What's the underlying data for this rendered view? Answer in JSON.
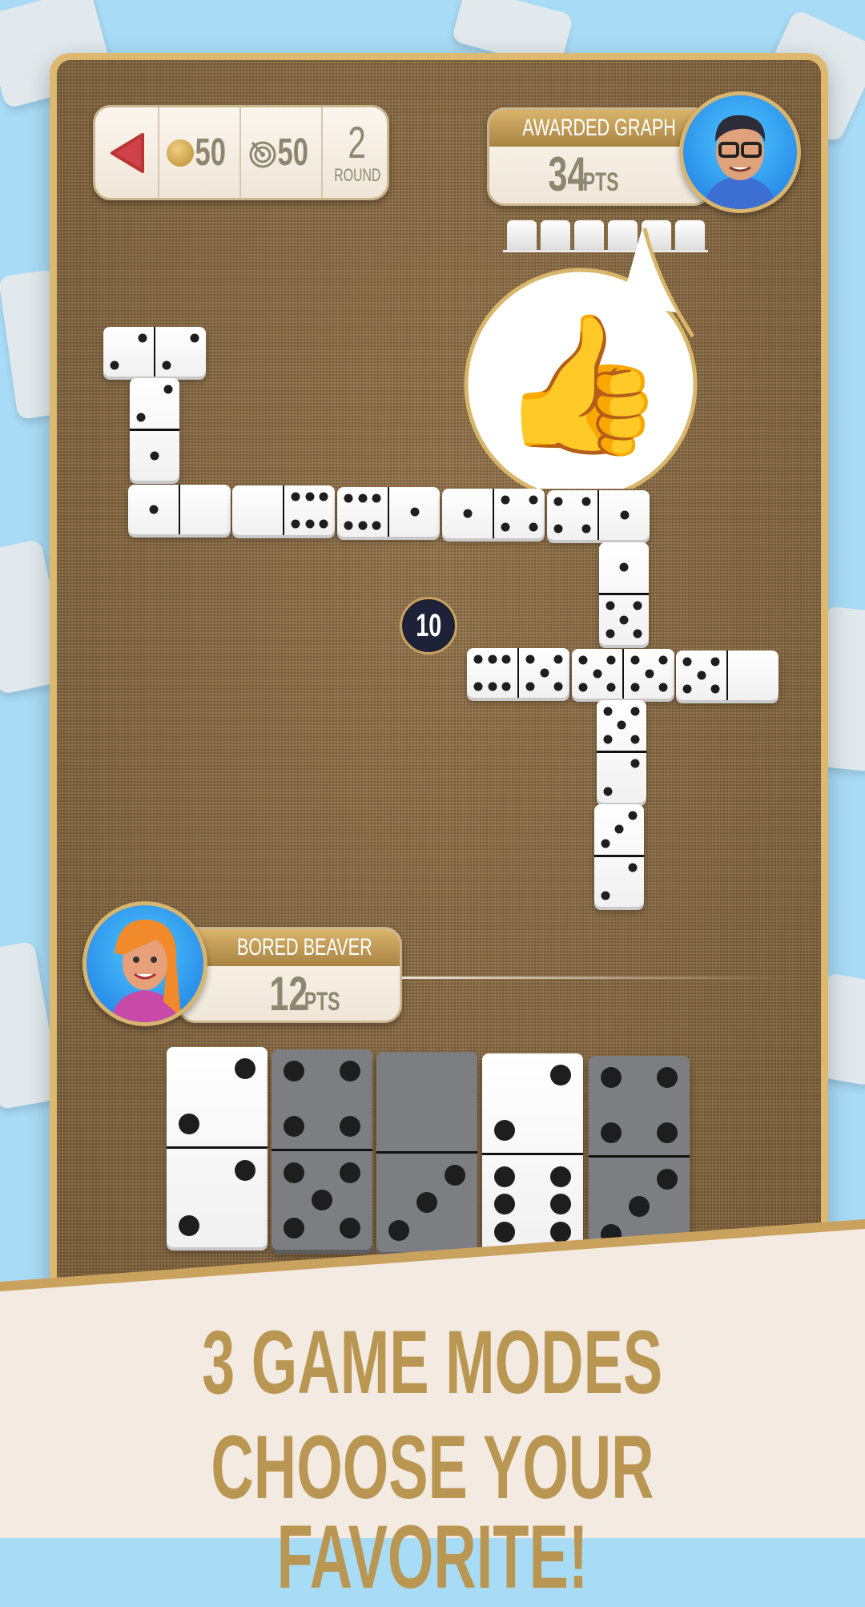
{
  "hud": {
    "back_icon": "back-triangle-icon",
    "coins": "50",
    "target": "50",
    "round_number": "2",
    "round_label": "ROUND"
  },
  "opponent": {
    "name": "AWARDED GRAPH",
    "points": "34",
    "pts_label": "PTS",
    "tiles_remaining": 6,
    "reaction": "👍"
  },
  "player": {
    "name": "BORED BEAVER",
    "points": "12",
    "pts_label": "PTS"
  },
  "board_score": "10",
  "board_tiles": [
    [
      2,
      2
    ],
    [
      2,
      1
    ],
    [
      1,
      0
    ],
    [
      0,
      6
    ],
    [
      6,
      1
    ],
    [
      1,
      4
    ],
    [
      4,
      1
    ],
    [
      1,
      5
    ],
    [
      6,
      5
    ],
    [
      5,
      5
    ],
    [
      5,
      0
    ],
    [
      5,
      2
    ],
    [
      3,
      2
    ]
  ],
  "hand": [
    {
      "a": 2,
      "b": 2,
      "playable": true
    },
    {
      "a": 4,
      "b": 5,
      "playable": false
    },
    {
      "a": 0,
      "b": 3,
      "playable": false
    },
    {
      "a": 2,
      "b": 6,
      "playable": true
    },
    {
      "a": 4,
      "b": 3,
      "playable": false
    }
  ],
  "banner": {
    "line1": "3 GAME MODES",
    "line2": "CHOOSE YOUR FAVORITE!"
  },
  "colors": {
    "gold": "#b99752",
    "felt": "#8a6a40",
    "sky": "#a8dcf6",
    "back": "#d0424a"
  }
}
